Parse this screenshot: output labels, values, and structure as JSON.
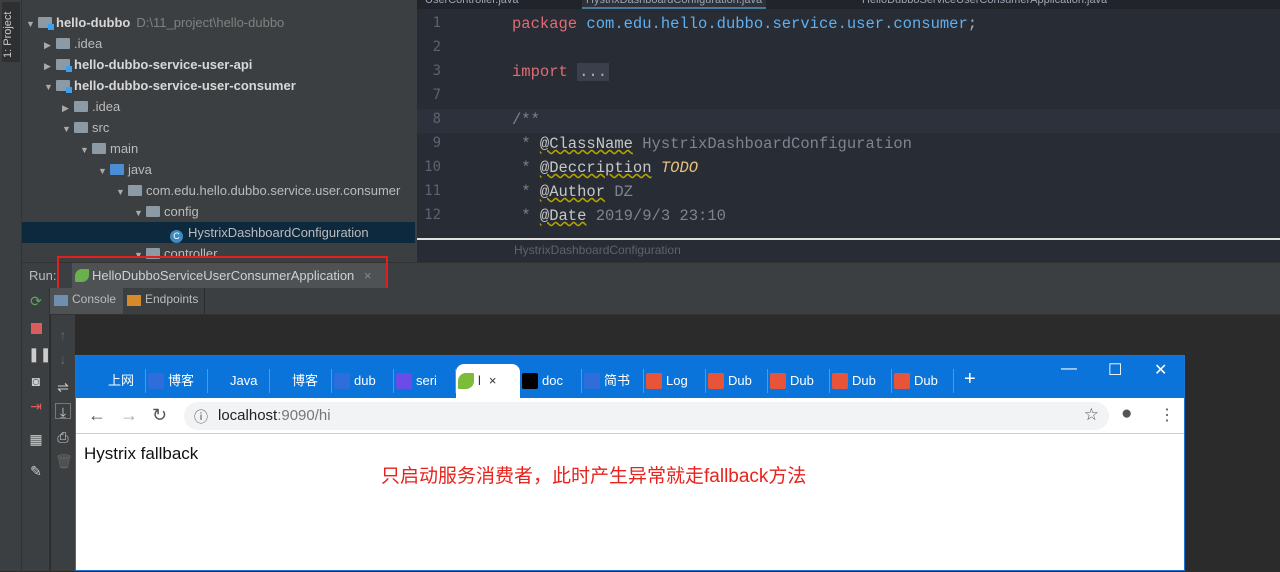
{
  "sidebar": {
    "strip_label": "1: Project"
  },
  "tree": {
    "rows": [
      {
        "label": "hello-dubbo",
        "path": "D:\\11_project\\hello-dubbo"
      },
      {
        "label": ".idea"
      },
      {
        "label": "hello-dubbo-service-user-api"
      },
      {
        "label": "hello-dubbo-service-user-consumer"
      },
      {
        "label": ".idea"
      },
      {
        "label": "src"
      },
      {
        "label": "main"
      },
      {
        "label": "java"
      },
      {
        "label": "com.edu.hello.dubbo.service.user.consumer"
      },
      {
        "label": "config"
      },
      {
        "label": "HystrixDashboardConfiguration"
      },
      {
        "label": "controller"
      }
    ]
  },
  "editor": {
    "tabs": [
      "UserController.java",
      "HystrixDashboardConfiguration.java",
      "HelloDubboServiceUserConsumerApplication.java"
    ],
    "line_numbers": [
      "1",
      "2",
      "3",
      "7",
      "8",
      "9",
      "10",
      "11",
      "12"
    ],
    "code": {
      "package_kw": "package",
      "package_name": " com.edu.hello.dubbo.service.user.consumer",
      "semi": ";",
      "import_kw": "import",
      "import_dots": "...",
      "doc_open": "/**",
      "classname_tag": "@ClassName",
      "classname_val": " HystrixDashboardConfiguration",
      "desc_tag": "@Deccription",
      "desc_val": "TODO",
      "author_tag": "@Author",
      "author_val": " DZ",
      "date_tag": "@Date",
      "date_val": " 2019/9/3 23:10"
    },
    "breadcrumb": "HystrixDashboardConfiguration"
  },
  "run": {
    "label": "Run:",
    "tab": "HelloDubboServiceUserConsumerApplication",
    "close": "×",
    "console_tab": "Console",
    "endpoints_tab": "Endpoints"
  },
  "browser": {
    "tabs": [
      {
        "icon": "ie-icon",
        "label": "上网",
        "color": "#0a74da"
      },
      {
        "icon": "baidu-icon",
        "label": "博客",
        "color": "#2f6ddb"
      },
      {
        "icon": "idea-icon",
        "label": "Java",
        "color": "#0a74da"
      },
      {
        "icon": "idea-icon",
        "label": "博客",
        "color": "#0a74da"
      },
      {
        "icon": "baidu-icon",
        "label": "dub",
        "color": "#2f6ddb"
      },
      {
        "icon": "d-icon",
        "label": "seri",
        "color": "#6a4ce8"
      },
      {
        "icon": "spring-leaf-icon",
        "label": "l",
        "color": "#7dbb3a",
        "active": true
      },
      {
        "icon": "a-icon",
        "label": "doc",
        "color": "#000000"
      },
      {
        "icon": "baidu-icon",
        "label": "简书",
        "color": "#2f6ddb"
      },
      {
        "icon": "jianshu-icon",
        "label": "Log",
        "color": "#e8543a"
      },
      {
        "icon": "jianshu-icon",
        "label": "Dub",
        "color": "#e8543a"
      },
      {
        "icon": "jianshu-icon",
        "label": "Dub",
        "color": "#e8543a"
      },
      {
        "icon": "jianshu-icon",
        "label": "Dub",
        "color": "#e8543a"
      },
      {
        "icon": "jianshu-icon",
        "label": "Dub",
        "color": "#e8543a"
      }
    ],
    "tab_close": "×",
    "new_tab": "+",
    "url_host": "localhost",
    "url_rest": ":9090/hi",
    "page_text": "Hystrix fallback",
    "annotation": "只启动服务消费者，此时产生异常就走fallback方法"
  }
}
